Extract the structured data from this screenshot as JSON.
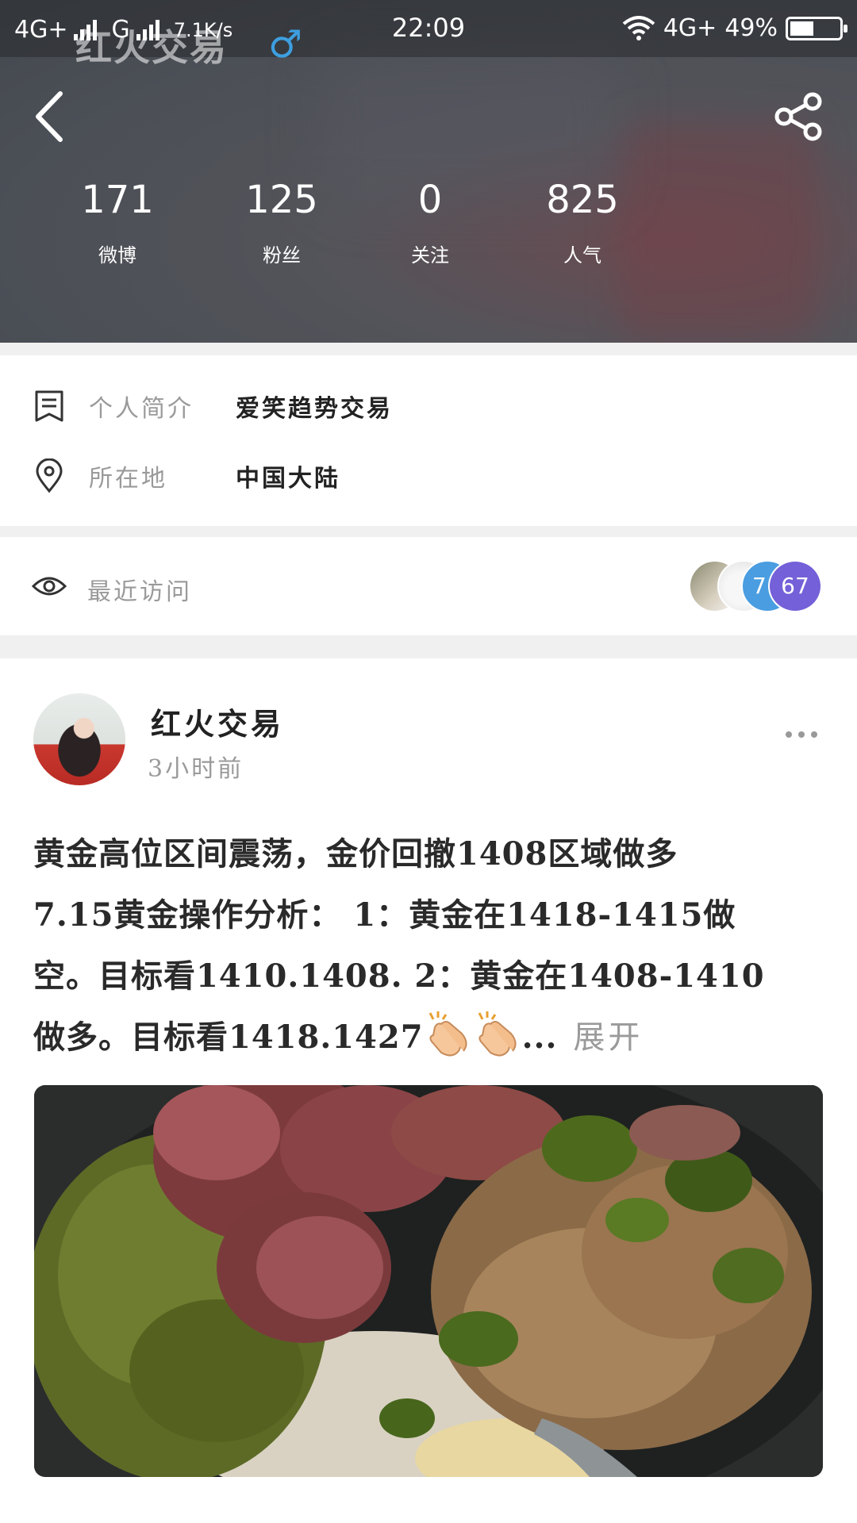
{
  "status_bar": {
    "network_left": "4G+",
    "network_mid": "G",
    "speed": "7.1K/s",
    "time": "22:09",
    "network_right": "4G+",
    "battery": "49%",
    "battery_level": 0.49
  },
  "header": {
    "ghost_title": "红火交易",
    "gender_symbol": "♂",
    "stats": [
      {
        "value": "171",
        "label": "微博"
      },
      {
        "value": "125",
        "label": "粉丝"
      },
      {
        "value": "0",
        "label": "关注"
      },
      {
        "value": "825",
        "label": "人气"
      }
    ]
  },
  "profile": {
    "bio_label": "个人简介",
    "bio_value": "爱笑趋势交易",
    "location_label": "所在地",
    "location_value": "中国大陆"
  },
  "visits": {
    "label": "最近访问",
    "count_a": "7",
    "count_b": "67"
  },
  "post": {
    "author": "红火交易",
    "time": "3小时前",
    "lines": [
      "黄金高位区间震荡，金价回撤1408区域做多",
      "7.15黄金操作分析： 1：黄金在1418-1415做",
      "空。目标看1410.1408. 2：黄金在1408-1410",
      "做多。目标看1418.1427"
    ],
    "ellipsis": "...",
    "expand_label": "展开"
  },
  "colors": {
    "accent_blue": "#4a9de0",
    "accent_purple": "#7460d8",
    "gender_blue": "#3d9fe0"
  }
}
